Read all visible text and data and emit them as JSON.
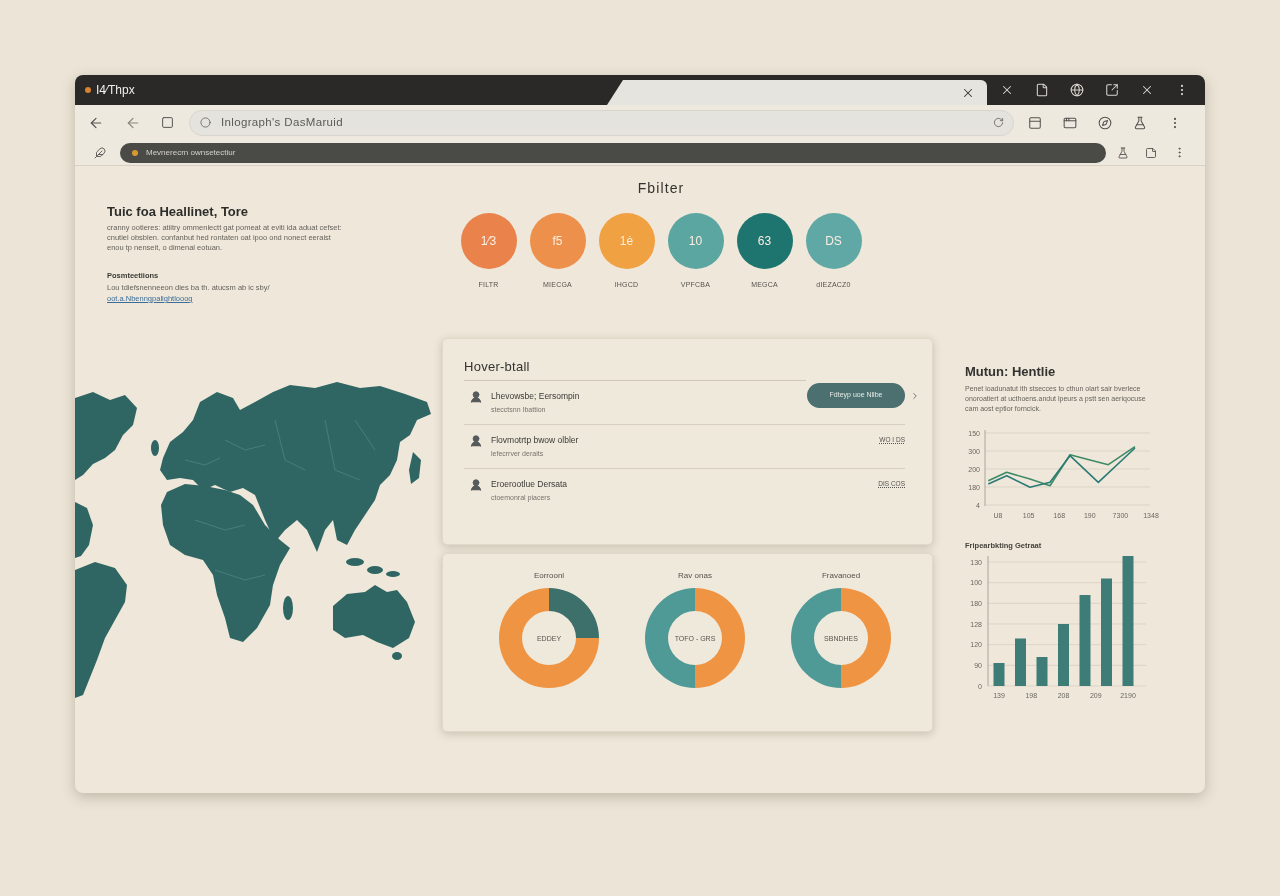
{
  "browser": {
    "tab_title": "I4⁄Thpx",
    "address": "Inlograph's DasMaruid",
    "bookmark_bar": "Mevnerecrn ownsetectiur"
  },
  "intro": {
    "title": "Tuic foa Heallinet, Tore",
    "body": "cranny ootieres: atiitry ommenlectt gat pomeat at eviti ida aduat cefset: cnutiel obsblen. confanbut hed rontaten oat ipoo ond nonect eeraist enou tp nenseit, o dimenal eotuan.",
    "subheading": "Posmteetiions",
    "note": "Lou tdiefsnenneeon dies ba th. atucsm ab ic sby/",
    "link": "oot.a.Nbenngpalightlooog"
  },
  "filter": {
    "title": "Fbilter",
    "items": [
      {
        "glyph": "1⁄3",
        "label": "FILTR",
        "color": "#e9834b"
      },
      {
        "glyph": "f5",
        "label": "MIECGA",
        "color": "#ec904b"
      },
      {
        "glyph": "1ė",
        "label": "IHGCD",
        "color": "#f0a142"
      },
      {
        "glyph": "10",
        "label": "VPFCBA",
        "color": "#5ba6a1"
      },
      {
        "glyph": "63",
        "label": "MEGCA",
        "color": "#1e7570"
      },
      {
        "glyph": "DS",
        "label": "dIEZACZ0",
        "color": "#60a8a6"
      }
    ]
  },
  "hover_detail": {
    "title": "Hover-btall",
    "rows": [
      {
        "name": "Lhevowsbe; Eersompin",
        "detail": "stecctsnn Ibattion",
        "button": "Fdteyp uoe Nllbe"
      },
      {
        "name": "Flovmotrtp bwow olbler",
        "detail": "lefecrrver deraits",
        "tag": "WO I DS"
      },
      {
        "name": "Eroerootlue Dersata",
        "detail": "ctoemonral piacers",
        "tag": "DIS COS"
      }
    ]
  },
  "donuts": [
    {
      "center_label": "EDDEY",
      "chart_data": {
        "type": "donut",
        "title": "Eorroonl",
        "values": [
          25,
          75
        ],
        "colors": [
          "#3e706b",
          "#ef9442"
        ]
      }
    },
    {
      "center_label": "TOFO - GRS",
      "chart_data": {
        "type": "donut",
        "title": "Rav onas",
        "values": [
          50,
          50
        ],
        "colors": [
          "#ef9442",
          "#4f9a97"
        ]
      }
    },
    {
      "center_label": "SBNDHES",
      "chart_data": {
        "type": "donut",
        "title": "Fravanoed",
        "values": [
          50,
          50
        ],
        "colors": [
          "#ef9442",
          "#4f9a97"
        ]
      }
    }
  ],
  "side_panel": {
    "title": "Mutun: Hentlie",
    "body": "Penet ioadunatut ith stsecces to cthun olart sair bverlece onoroatiert at ucthoens.andut lpeurs a pstt sen aeriqocuse cam aost eptlor forncick.",
    "line_chart": {
      "y_labels": [
        "150",
        "300",
        "200",
        "180",
        "4"
      ],
      "x_labels": [
        "U8",
        "105",
        "168",
        "190",
        "7300",
        "1348"
      ]
    },
    "bar_chart": {
      "title": "Fripearbkting Getraat",
      "y_labels": [
        "130",
        "100",
        "180",
        "128",
        "120",
        "90",
        "0"
      ],
      "x_labels": [
        "139",
        "198",
        "208",
        "209",
        "2190"
      ]
    }
  }
}
